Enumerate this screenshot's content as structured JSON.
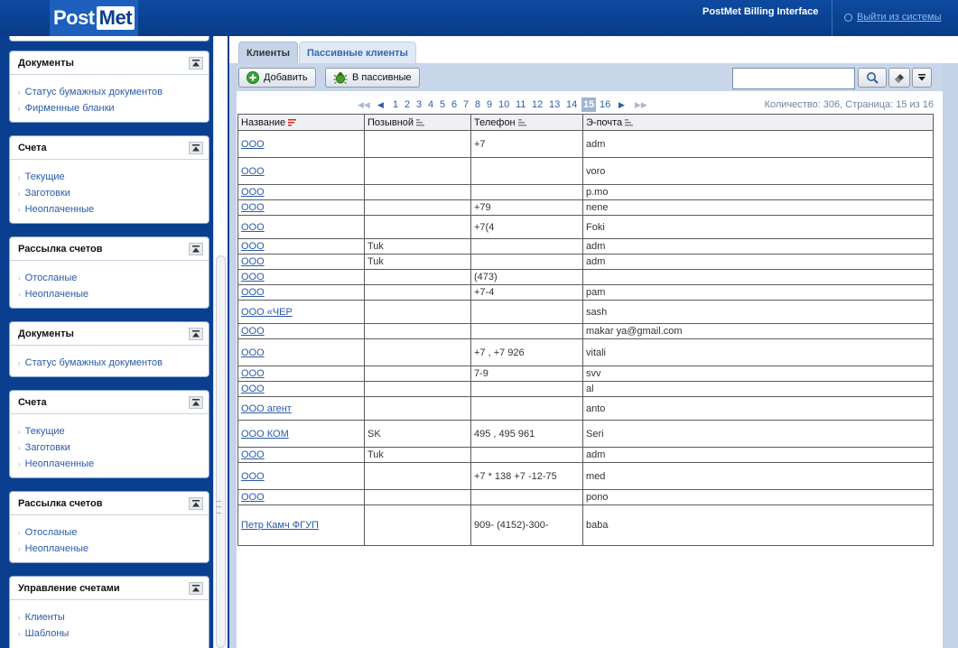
{
  "header": {
    "logo_part1": "Post",
    "logo_part2": "Met",
    "app_title": "PostMet Billing Interface",
    "logout_label": "Выйти из системы"
  },
  "sidebar": {
    "panels": [
      {
        "title": "Документы",
        "items": [
          "Статус бумажных документов",
          "Фирменные бланки"
        ]
      },
      {
        "title": "Счета",
        "items": [
          "Текущие",
          "Заготовки",
          "Неоплаченные"
        ]
      },
      {
        "title": "Рассылка счетов",
        "items": [
          "Отосланые",
          "Неоплаченые"
        ]
      },
      {
        "title": "Документы",
        "items": [
          "Статус бумажных документов"
        ]
      },
      {
        "title": "Счета",
        "items": [
          "Текущие",
          "Заготовки",
          "Неоплаченные"
        ]
      },
      {
        "title": "Рассылка счетов",
        "items": [
          "Отосланые",
          "Неоплаченые"
        ]
      },
      {
        "title": "Управление счетами",
        "items": [
          "Клиенты",
          "Шаблоны"
        ]
      }
    ]
  },
  "tabs": [
    {
      "label": "Клиенты",
      "active": true
    },
    {
      "label": "Пассивные клиенты",
      "active": false
    }
  ],
  "toolbar": {
    "add_label": "Добавить",
    "passive_label": "В пассивные",
    "search_value": ""
  },
  "pager": {
    "pages": [
      "1",
      "2",
      "3",
      "4",
      "5",
      "6",
      "7",
      "8",
      "9",
      "10",
      "11",
      "12",
      "13",
      "14",
      "15",
      "16"
    ],
    "current": "15",
    "summary": "Количество: 306, Страница: 15 из 16"
  },
  "table": {
    "columns": [
      "Название",
      "Позывной",
      "Телефон",
      "Э-почта"
    ],
    "rows": [
      {
        "name": "ООО",
        "callsign": "",
        "phone": "+7",
        "email": "adm"
      },
      {
        "name": "ООО",
        "callsign": "",
        "phone": "",
        "email": "voro"
      },
      {
        "name": "ООО",
        "callsign": "",
        "phone": "",
        "email": "p.mo"
      },
      {
        "name": "ООО",
        "callsign": "",
        "phone": "+79",
        "email": "nene"
      },
      {
        "name": "ООО",
        "callsign": "",
        "phone": "+7(4",
        "email": "Foki"
      },
      {
        "name": "ООО",
        "callsign": "Tuk",
        "phone": "",
        "email": "adm"
      },
      {
        "name": "ООО",
        "callsign": "Tuk",
        "phone": "",
        "email": "adm"
      },
      {
        "name": "ООО",
        "callsign": "",
        "phone": "(473)",
        "email": ""
      },
      {
        "name": "ООО",
        "callsign": "",
        "phone": "+7-4",
        "email": "pam"
      },
      {
        "name": "ООО «ЧЕР",
        "callsign": "",
        "phone": "",
        "email": "sash"
      },
      {
        "name": "ООО",
        "callsign": "",
        "phone": "",
        "email": "makar ya@gmail.com"
      },
      {
        "name": "ООО",
        "callsign": "",
        "phone": "+7 , +7 926",
        "email": "vitali"
      },
      {
        "name": "ООО",
        "callsign": "",
        "phone": "7-9",
        "email": "svv"
      },
      {
        "name": "ООО",
        "callsign": "",
        "phone": "",
        "email": "al"
      },
      {
        "name": "ООО агент",
        "callsign": "",
        "phone": "",
        "email": "anto"
      },
      {
        "name": "ООО КОМ",
        "callsign": "SK",
        "phone": "495 , 495 961",
        "email": "Seri"
      },
      {
        "name": "ООО",
        "callsign": "Tuk",
        "phone": "",
        "email": "adm"
      },
      {
        "name": "ООО",
        "callsign": "",
        "phone": "+7 * 138 +7 -12-75",
        "email": "med"
      },
      {
        "name": "ООО",
        "callsign": "",
        "phone": "",
        "email": "pono"
      },
      {
        "name": "Петр Камч ФГУП",
        "callsign": "",
        "phone": "909- (4152)-300-",
        "email": "baba"
      }
    ]
  },
  "colors": {
    "header_bg": "#0b3f8a",
    "link": "#2a5aa8",
    "content_bg": "#c4d3e8"
  }
}
